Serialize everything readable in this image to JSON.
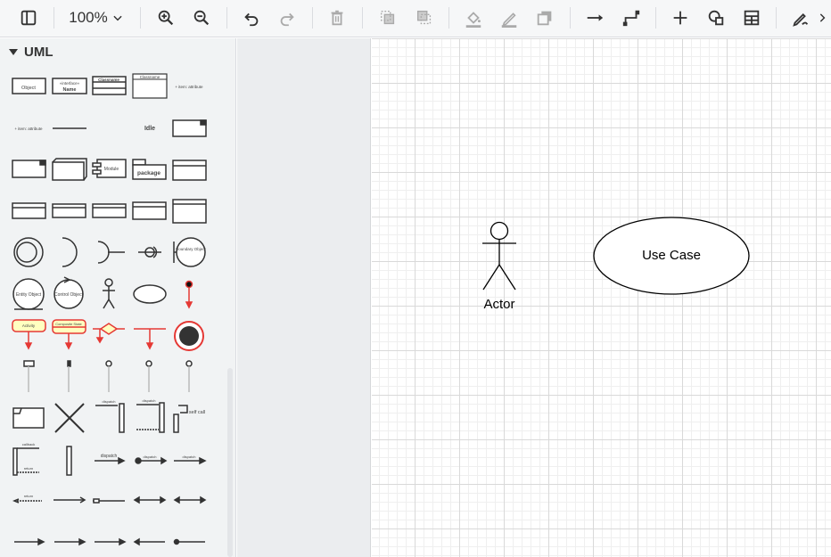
{
  "toolbar": {
    "zoom_level": "100%",
    "icons": [
      "sidebar-toggle-icon",
      "zoom-in-icon",
      "zoom-out-icon",
      "undo-icon",
      "redo-icon",
      "delete-icon",
      "to-front-icon",
      "to-back-icon",
      "fill-color-icon",
      "line-color-icon",
      "shadow-icon",
      "connection-icon",
      "waypoints-icon",
      "insert-icon",
      "shapes-icon",
      "table-icon",
      "edit-style-icon"
    ]
  },
  "sidebar": {
    "section_title": "UML",
    "shapes": {
      "object": "Object",
      "interface": "Name",
      "interface_stereo": "«interface»",
      "classname": "Classname",
      "item_attribute": "+ item: attribute",
      "idle": "Idle",
      "module": "Module",
      "package": "package",
      "boundary": "Boundary Object",
      "entity": "Entity Object",
      "control": "Control Object",
      "activity": "Activity",
      "composite_state": "Composite State",
      "self_call": "self call",
      "dispatch": "dispatch",
      "callback": "callback",
      "return": "return"
    }
  },
  "canvas": {
    "actor_label": "Actor",
    "usecase_label": "Use Case"
  },
  "colors": {
    "accent_red": "#e53935",
    "activity_fill": "#ffffc0",
    "grid_major": "#d9d9d9",
    "grid_minor": "#efefef"
  }
}
